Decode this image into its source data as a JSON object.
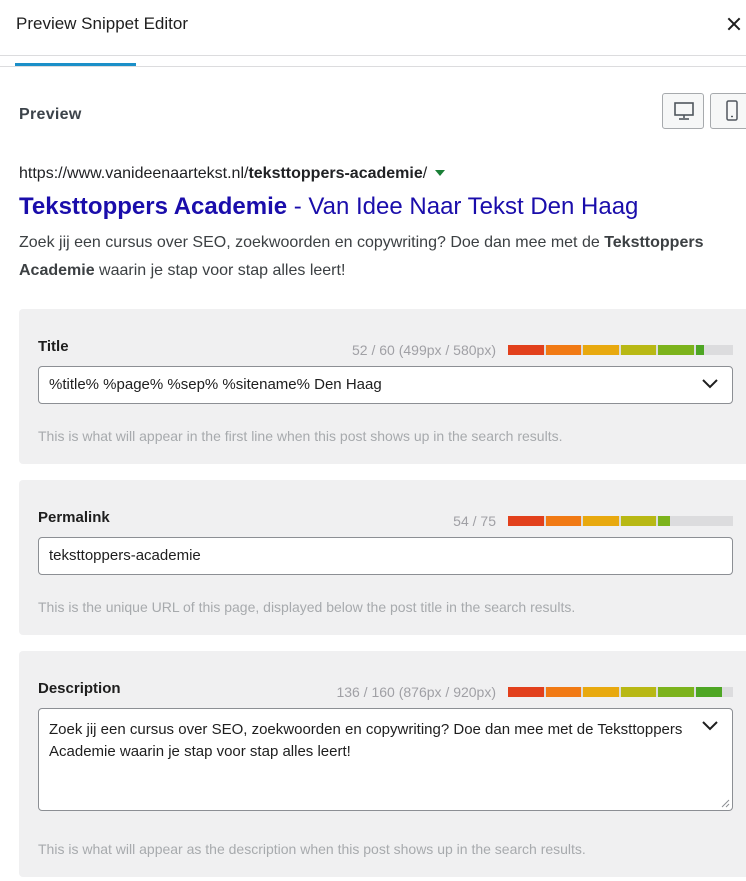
{
  "modal": {
    "title": "Preview Snippet Editor",
    "close_label": "close"
  },
  "preview": {
    "label": "Preview",
    "url_prefix": "https://www.vanideenaartekst.nl/",
    "url_slug": "teksttoppers-academie",
    "url_suffix": "/",
    "title_bold": "Teksttoppers Academie",
    "title_rest": " - Van Idee Naar Tekst Den Haag",
    "desc_part1": "Zoek jij een cursus over SEO, zoekwoorden en copywriting? Doe dan mee met de ",
    "desc_bold": "Teksttoppers Academie",
    "desc_part2": " waarin je stap voor stap alles leert!",
    "device_buttons": [
      "desktop-icon",
      "mobile-icon"
    ]
  },
  "fields": {
    "title": {
      "label": "Title",
      "count": "52 / 60 (499px / 580px)",
      "fill_fraction": 0.87,
      "value": "%title% %page% %sep% %sitename% Den Haag",
      "help": "This is what will appear in the first line when this post shows up in the search results."
    },
    "permalink": {
      "label": "Permalink",
      "count": "54 / 75",
      "fill_fraction": 0.72,
      "value": "teksttoppers-academie",
      "help": "This is the unique URL of this page, displayed below the post title in the search results."
    },
    "description": {
      "label": "Description",
      "count": "136 / 160 (876px / 920px)",
      "fill_fraction": 0.95,
      "value": "Zoek jij een cursus over SEO, zoekwoorden en copywriting? Doe dan mee met de Teksttoppers Academie waarin je stap voor stap alles leert!",
      "help": "This is what will appear as the description when this post shows up in the search results."
    }
  },
  "colors": {
    "accent": "#1b8fc8",
    "link_title": "#1a0dab",
    "url_arrow": "#1a7f37",
    "meter_segments": [
      "#e2401c",
      "#f17a14",
      "#e8a90f",
      "#b8b814",
      "#7cb31c",
      "#4ea624"
    ]
  }
}
